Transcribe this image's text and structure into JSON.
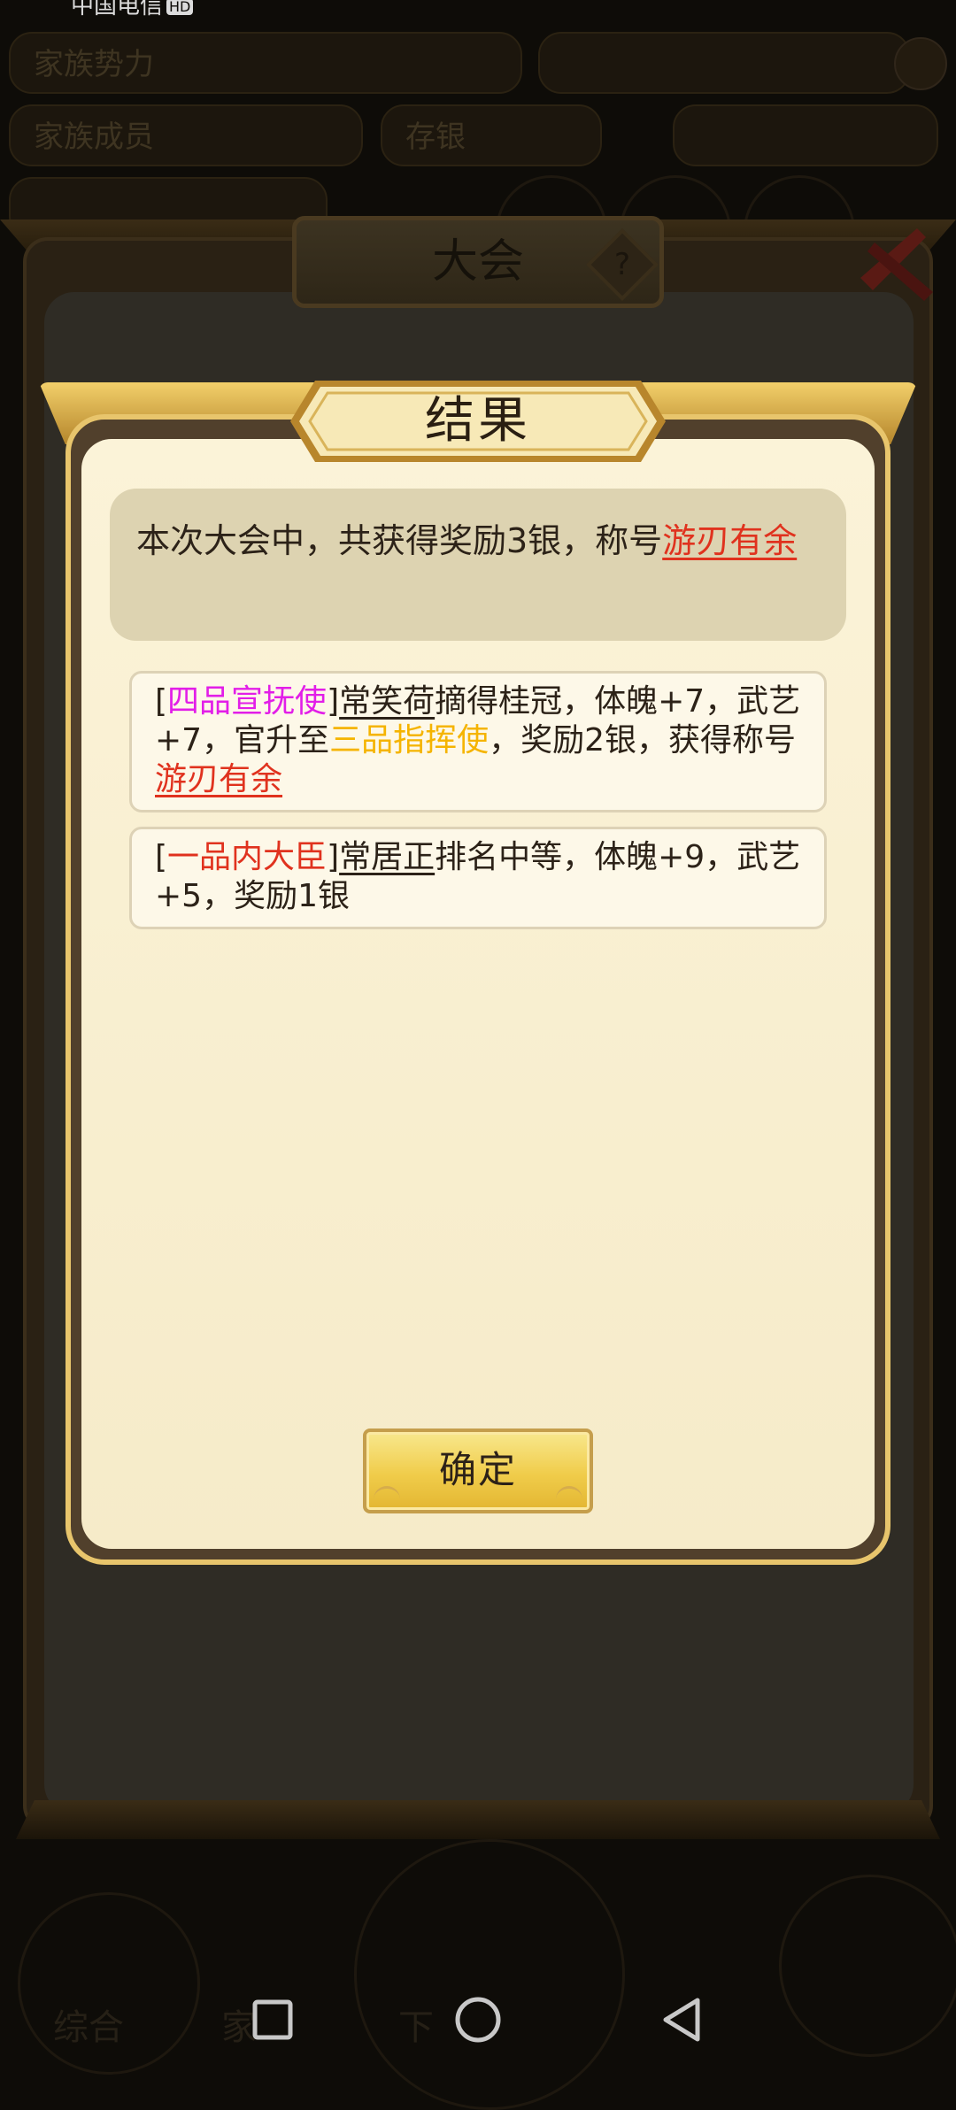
{
  "status_bar": {
    "carrier": "中国电信",
    "hd_badge": "HD"
  },
  "background": {
    "stat_bars": [
      "家族势力",
      "家族成员",
      "存银"
    ],
    "bottom_tabs": [
      "综合",
      "家",
      "下"
    ]
  },
  "outer_panel": {
    "title": "大会",
    "help_icon": "?"
  },
  "dialog": {
    "title": "结果",
    "summary": {
      "text": "本次大会中，共获得奖励3银，称号",
      "title_name": "游刃有余"
    },
    "log": [
      {
        "bracket_open": "[",
        "rank": "四品宣抚使",
        "bracket_close": "]",
        "person": "常笑荷",
        "text1": "摘得桂冠，体魄+7，武艺+7，官升至",
        "new_rank": "三品指挥使",
        "text2": "，奖励2银，获得称号",
        "title_name": "游刃有余"
      },
      {
        "bracket_open": "[",
        "rank": "一品内大臣",
        "bracket_close": "]",
        "person": "常居正",
        "text1": "排名中等，体魄+9，武艺+5，奖励1银"
      }
    ],
    "confirm_label": "确定"
  },
  "colors": {
    "rank_purple": "#e21ee8",
    "rank_gold": "#f5b400",
    "highlight_red": "#e0321e",
    "button_gold": "#f0cc4a",
    "dialog_bg": "#fbf3d8"
  },
  "icons": [
    "hd-icon",
    "help-icon",
    "close-icon",
    "recent-apps-icon",
    "home-icon",
    "back-icon"
  ]
}
